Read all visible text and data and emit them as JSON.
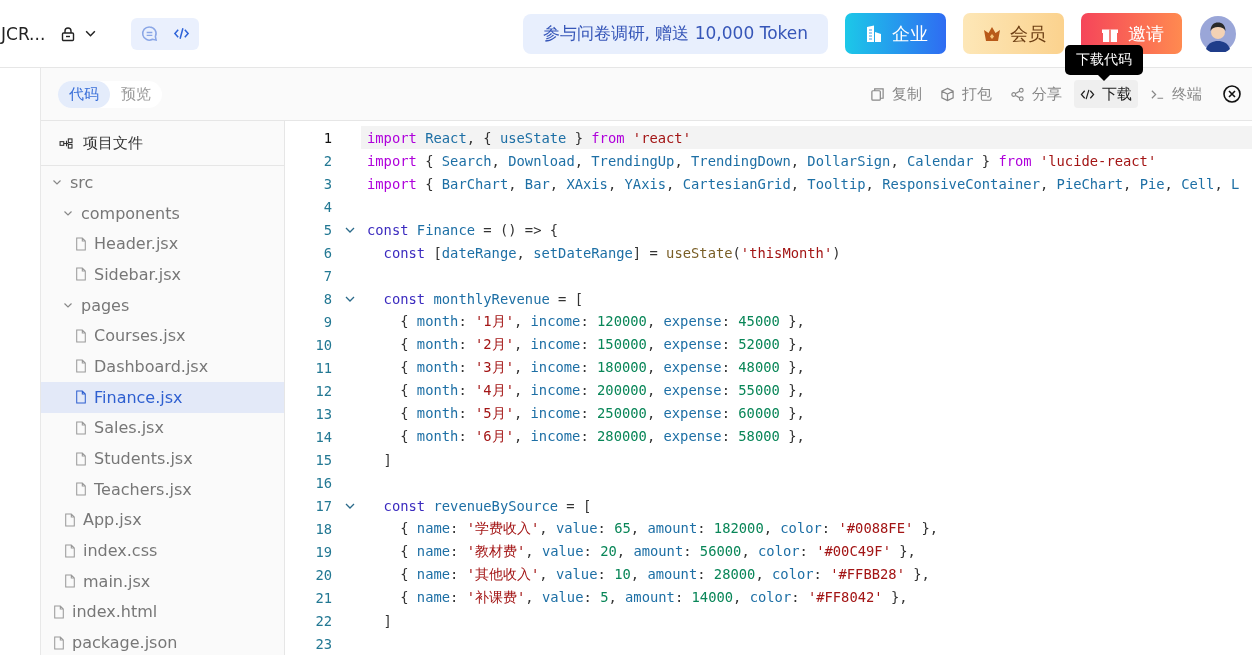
{
  "header": {
    "project_title": "JCR...",
    "view_toggle": [
      {
        "kind": "chat",
        "selected": false
      },
      {
        "kind": "code",
        "selected": true
      }
    ],
    "survey_banner": "参与问卷调研, 赠送 10,000 Token",
    "buttons": [
      {
        "kind": "enterprise",
        "label": "企业"
      },
      {
        "kind": "member",
        "label": "会员"
      },
      {
        "kind": "invite",
        "label": "邀请"
      }
    ]
  },
  "tooltip": "下载代码",
  "toolbar": {
    "tabs": [
      {
        "label": "代码",
        "selected": true
      },
      {
        "label": "预览",
        "selected": false
      }
    ],
    "actions": [
      {
        "kind": "copy",
        "label": "复制",
        "selected": false
      },
      {
        "kind": "package",
        "label": "打包",
        "selected": false
      },
      {
        "kind": "share",
        "label": "分享",
        "selected": false
      },
      {
        "kind": "code",
        "label": "下载",
        "selected": true
      },
      {
        "kind": "terminal",
        "label": "终端",
        "selected": false
      }
    ]
  },
  "sidebar": {
    "title": "项目文件",
    "tree": [
      {
        "name": "src",
        "kind": "folder",
        "expanded": true,
        "selected": false,
        "children": [
          {
            "name": "components",
            "kind": "folder",
            "expanded": true,
            "selected": false,
            "children": [
              {
                "name": "Header.jsx",
                "kind": "file",
                "selected": false
              },
              {
                "name": "Sidebar.jsx",
                "kind": "file",
                "selected": false
              }
            ]
          },
          {
            "name": "pages",
            "kind": "folder",
            "expanded": true,
            "selected": false,
            "children": [
              {
                "name": "Courses.jsx",
                "kind": "file",
                "selected": false
              },
              {
                "name": "Dashboard.jsx",
                "kind": "file",
                "selected": false
              },
              {
                "name": "Finance.jsx",
                "kind": "file",
                "selected": true
              },
              {
                "name": "Sales.jsx",
                "kind": "file",
                "selected": false
              },
              {
                "name": "Students.jsx",
                "kind": "file",
                "selected": false
              },
              {
                "name": "Teachers.jsx",
                "kind": "file",
                "selected": false
              }
            ]
          },
          {
            "name": "App.jsx",
            "kind": "file",
            "selected": false
          },
          {
            "name": "index.css",
            "kind": "file",
            "selected": false
          },
          {
            "name": "main.jsx",
            "kind": "file",
            "selected": false
          }
        ]
      },
      {
        "name": "index.html",
        "kind": "file",
        "selected": false
      },
      {
        "name": "package.json",
        "kind": "file",
        "selected": false
      }
    ]
  },
  "editor": {
    "lines": [
      {
        "number": "1",
        "active": true,
        "foldable": false,
        "tokens": [
          {
            "kind": "keyword",
            "text": "import"
          },
          {
            "kind": "name",
            "text": " React"
          },
          {
            "kind": "punct",
            "text": ", { "
          },
          {
            "kind": "name",
            "text": "useState"
          },
          {
            "kind": "punct",
            "text": " } "
          },
          {
            "kind": "keyword",
            "text": "from"
          },
          {
            "kind": "string",
            "text": " 'react'"
          }
        ]
      },
      {
        "number": "2",
        "active": false,
        "foldable": false,
        "tokens": [
          {
            "kind": "keyword",
            "text": "import"
          },
          {
            "kind": "punct",
            "text": " { "
          },
          {
            "kind": "name",
            "text": "Search"
          },
          {
            "kind": "punct",
            "text": ", "
          },
          {
            "kind": "name",
            "text": "Download"
          },
          {
            "kind": "punct",
            "text": ", "
          },
          {
            "kind": "name",
            "text": "TrendingUp"
          },
          {
            "kind": "punct",
            "text": ", "
          },
          {
            "kind": "name",
            "text": "TrendingDown"
          },
          {
            "kind": "punct",
            "text": ", "
          },
          {
            "kind": "name",
            "text": "DollarSign"
          },
          {
            "kind": "punct",
            "text": ", "
          },
          {
            "kind": "name",
            "text": "Calendar"
          },
          {
            "kind": "punct",
            "text": " } "
          },
          {
            "kind": "keyword",
            "text": "from"
          },
          {
            "kind": "string",
            "text": " 'lucide-react'"
          }
        ]
      },
      {
        "number": "3",
        "active": false,
        "foldable": false,
        "tokens": [
          {
            "kind": "keyword",
            "text": "import"
          },
          {
            "kind": "punct",
            "text": " { "
          },
          {
            "kind": "name",
            "text": "BarChart"
          },
          {
            "kind": "punct",
            "text": ", "
          },
          {
            "kind": "name",
            "text": "Bar"
          },
          {
            "kind": "punct",
            "text": ", "
          },
          {
            "kind": "name",
            "text": "XAxis"
          },
          {
            "kind": "punct",
            "text": ", "
          },
          {
            "kind": "name",
            "text": "YAxis"
          },
          {
            "kind": "punct",
            "text": ", "
          },
          {
            "kind": "name",
            "text": "CartesianGrid"
          },
          {
            "kind": "punct",
            "text": ", "
          },
          {
            "kind": "name",
            "text": "Tooltip"
          },
          {
            "kind": "punct",
            "text": ", "
          },
          {
            "kind": "name",
            "text": "ResponsiveContainer"
          },
          {
            "kind": "punct",
            "text": ", "
          },
          {
            "kind": "name",
            "text": "PieChart"
          },
          {
            "kind": "punct",
            "text": ", "
          },
          {
            "kind": "name",
            "text": "Pie"
          },
          {
            "kind": "punct",
            "text": ", "
          },
          {
            "kind": "name",
            "text": "Cell"
          },
          {
            "kind": "punct",
            "text": ", "
          },
          {
            "kind": "name",
            "text": "L"
          }
        ]
      },
      {
        "number": "4",
        "active": false,
        "foldable": false
      },
      {
        "number": "5",
        "active": false,
        "foldable": true,
        "tokens": [
          {
            "kind": "declare",
            "text": "const"
          },
          {
            "kind": "name",
            "text": " Finance"
          },
          {
            "kind": "punct",
            "text": " = () => {"
          }
        ]
      },
      {
        "number": "6",
        "active": false,
        "foldable": false,
        "tokens": [
          {
            "kind": "declare",
            "text": "  const"
          },
          {
            "kind": "punct",
            "text": " ["
          },
          {
            "kind": "name",
            "text": "dateRange"
          },
          {
            "kind": "punct",
            "text": ", "
          },
          {
            "kind": "name",
            "text": "setDateRange"
          },
          {
            "kind": "punct",
            "text": "] = "
          },
          {
            "kind": "func",
            "text": "useState"
          },
          {
            "kind": "punct",
            "text": "("
          },
          {
            "kind": "string",
            "text": "'thisMonth'"
          },
          {
            "kind": "punct",
            "text": ")"
          }
        ]
      },
      {
        "number": "7",
        "active": false,
        "foldable": false
      },
      {
        "number": "8",
        "active": false,
        "foldable": true,
        "tokens": [
          {
            "kind": "declare",
            "text": "  const"
          },
          {
            "kind": "name",
            "text": " monthlyRevenue"
          },
          {
            "kind": "punct",
            "text": " = ["
          }
        ]
      },
      {
        "number": "9",
        "active": false,
        "foldable": false,
        "tokens": [
          {
            "kind": "punct",
            "text": "    { "
          },
          {
            "kind": "name",
            "text": "month"
          },
          {
            "kind": "punct",
            "text": ": "
          },
          {
            "kind": "string",
            "text": "'1月'"
          },
          {
            "kind": "punct",
            "text": ", "
          },
          {
            "kind": "name",
            "text": "income"
          },
          {
            "kind": "punct",
            "text": ": "
          },
          {
            "kind": "number",
            "text": "120000"
          },
          {
            "kind": "punct",
            "text": ", "
          },
          {
            "kind": "name",
            "text": "expense"
          },
          {
            "kind": "punct",
            "text": ": "
          },
          {
            "kind": "number",
            "text": "45000"
          },
          {
            "kind": "punct",
            "text": " },"
          }
        ]
      },
      {
        "number": "10",
        "active": false,
        "foldable": false,
        "tokens": [
          {
            "kind": "punct",
            "text": "    { "
          },
          {
            "kind": "name",
            "text": "month"
          },
          {
            "kind": "punct",
            "text": ": "
          },
          {
            "kind": "string",
            "text": "'2月'"
          },
          {
            "kind": "punct",
            "text": ", "
          },
          {
            "kind": "name",
            "text": "income"
          },
          {
            "kind": "punct",
            "text": ": "
          },
          {
            "kind": "number",
            "text": "150000"
          },
          {
            "kind": "punct",
            "text": ", "
          },
          {
            "kind": "name",
            "text": "expense"
          },
          {
            "kind": "punct",
            "text": ": "
          },
          {
            "kind": "number",
            "text": "52000"
          },
          {
            "kind": "punct",
            "text": " },"
          }
        ]
      },
      {
        "number": "11",
        "active": false,
        "foldable": false,
        "tokens": [
          {
            "kind": "punct",
            "text": "    { "
          },
          {
            "kind": "name",
            "text": "month"
          },
          {
            "kind": "punct",
            "text": ": "
          },
          {
            "kind": "string",
            "text": "'3月'"
          },
          {
            "kind": "punct",
            "text": ", "
          },
          {
            "kind": "name",
            "text": "income"
          },
          {
            "kind": "punct",
            "text": ": "
          },
          {
            "kind": "number",
            "text": "180000"
          },
          {
            "kind": "punct",
            "text": ", "
          },
          {
            "kind": "name",
            "text": "expense"
          },
          {
            "kind": "punct",
            "text": ": "
          },
          {
            "kind": "number",
            "text": "48000"
          },
          {
            "kind": "punct",
            "text": " },"
          }
        ]
      },
      {
        "number": "12",
        "active": false,
        "foldable": false,
        "tokens": [
          {
            "kind": "punct",
            "text": "    { "
          },
          {
            "kind": "name",
            "text": "month"
          },
          {
            "kind": "punct",
            "text": ": "
          },
          {
            "kind": "string",
            "text": "'4月'"
          },
          {
            "kind": "punct",
            "text": ", "
          },
          {
            "kind": "name",
            "text": "income"
          },
          {
            "kind": "punct",
            "text": ": "
          },
          {
            "kind": "number",
            "text": "200000"
          },
          {
            "kind": "punct",
            "text": ", "
          },
          {
            "kind": "name",
            "text": "expense"
          },
          {
            "kind": "punct",
            "text": ": "
          },
          {
            "kind": "number",
            "text": "55000"
          },
          {
            "kind": "punct",
            "text": " },"
          }
        ]
      },
      {
        "number": "13",
        "active": false,
        "foldable": false,
        "tokens": [
          {
            "kind": "punct",
            "text": "    { "
          },
          {
            "kind": "name",
            "text": "month"
          },
          {
            "kind": "punct",
            "text": ": "
          },
          {
            "kind": "string",
            "text": "'5月'"
          },
          {
            "kind": "punct",
            "text": ", "
          },
          {
            "kind": "name",
            "text": "income"
          },
          {
            "kind": "punct",
            "text": ": "
          },
          {
            "kind": "number",
            "text": "250000"
          },
          {
            "kind": "punct",
            "text": ", "
          },
          {
            "kind": "name",
            "text": "expense"
          },
          {
            "kind": "punct",
            "text": ": "
          },
          {
            "kind": "number",
            "text": "60000"
          },
          {
            "kind": "punct",
            "text": " },"
          }
        ]
      },
      {
        "number": "14",
        "active": false,
        "foldable": false,
        "tokens": [
          {
            "kind": "punct",
            "text": "    { "
          },
          {
            "kind": "name",
            "text": "month"
          },
          {
            "kind": "punct",
            "text": ": "
          },
          {
            "kind": "string",
            "text": "'6月'"
          },
          {
            "kind": "punct",
            "text": ", "
          },
          {
            "kind": "name",
            "text": "income"
          },
          {
            "kind": "punct",
            "text": ": "
          },
          {
            "kind": "number",
            "text": "280000"
          },
          {
            "kind": "punct",
            "text": ", "
          },
          {
            "kind": "name",
            "text": "expense"
          },
          {
            "kind": "punct",
            "text": ": "
          },
          {
            "kind": "number",
            "text": "58000"
          },
          {
            "kind": "punct",
            "text": " },"
          }
        ]
      },
      {
        "number": "15",
        "active": false,
        "foldable": false,
        "tokens": [
          {
            "kind": "punct",
            "text": "  ]"
          }
        ]
      },
      {
        "number": "16",
        "active": false,
        "foldable": false
      },
      {
        "number": "17",
        "active": false,
        "foldable": true,
        "tokens": [
          {
            "kind": "declare",
            "text": "  const"
          },
          {
            "kind": "name",
            "text": " revenueBySource"
          },
          {
            "kind": "punct",
            "text": " = ["
          }
        ]
      },
      {
        "number": "18",
        "active": false,
        "foldable": false,
        "tokens": [
          {
            "kind": "punct",
            "text": "    { "
          },
          {
            "kind": "name",
            "text": "name"
          },
          {
            "kind": "punct",
            "text": ": "
          },
          {
            "kind": "string",
            "text": "'学费收入'"
          },
          {
            "kind": "punct",
            "text": ", "
          },
          {
            "kind": "name",
            "text": "value"
          },
          {
            "kind": "punct",
            "text": ": "
          },
          {
            "kind": "number",
            "text": "65"
          },
          {
            "kind": "punct",
            "text": ", "
          },
          {
            "kind": "name",
            "text": "amount"
          },
          {
            "kind": "punct",
            "text": ": "
          },
          {
            "kind": "number",
            "text": "182000"
          },
          {
            "kind": "punct",
            "text": ", "
          },
          {
            "kind": "name",
            "text": "color"
          },
          {
            "kind": "punct",
            "text": ": "
          },
          {
            "kind": "string",
            "text": "'#0088FE'"
          },
          {
            "kind": "punct",
            "text": " },"
          }
        ]
      },
      {
        "number": "19",
        "active": false,
        "foldable": false,
        "tokens": [
          {
            "kind": "punct",
            "text": "    { "
          },
          {
            "kind": "name",
            "text": "name"
          },
          {
            "kind": "punct",
            "text": ": "
          },
          {
            "kind": "string",
            "text": "'教材费'"
          },
          {
            "kind": "punct",
            "text": ", "
          },
          {
            "kind": "name",
            "text": "value"
          },
          {
            "kind": "punct",
            "text": ": "
          },
          {
            "kind": "number",
            "text": "20"
          },
          {
            "kind": "punct",
            "text": ", "
          },
          {
            "kind": "name",
            "text": "amount"
          },
          {
            "kind": "punct",
            "text": ": "
          },
          {
            "kind": "number",
            "text": "56000"
          },
          {
            "kind": "punct",
            "text": ", "
          },
          {
            "kind": "name",
            "text": "color"
          },
          {
            "kind": "punct",
            "text": ": "
          },
          {
            "kind": "string",
            "text": "'#00C49F'"
          },
          {
            "kind": "punct",
            "text": " },"
          }
        ]
      },
      {
        "number": "20",
        "active": false,
        "foldable": false,
        "tokens": [
          {
            "kind": "punct",
            "text": "    { "
          },
          {
            "kind": "name",
            "text": "name"
          },
          {
            "kind": "punct",
            "text": ": "
          },
          {
            "kind": "string",
            "text": "'其他收入'"
          },
          {
            "kind": "punct",
            "text": ", "
          },
          {
            "kind": "name",
            "text": "value"
          },
          {
            "kind": "punct",
            "text": ": "
          },
          {
            "kind": "number",
            "text": "10"
          },
          {
            "kind": "punct",
            "text": ", "
          },
          {
            "kind": "name",
            "text": "amount"
          },
          {
            "kind": "punct",
            "text": ": "
          },
          {
            "kind": "number",
            "text": "28000"
          },
          {
            "kind": "punct",
            "text": ", "
          },
          {
            "kind": "name",
            "text": "color"
          },
          {
            "kind": "punct",
            "text": ": "
          },
          {
            "kind": "string",
            "text": "'#FFBB28'"
          },
          {
            "kind": "punct",
            "text": " },"
          }
        ]
      },
      {
        "number": "21",
        "active": false,
        "foldable": false,
        "tokens": [
          {
            "kind": "punct",
            "text": "    { "
          },
          {
            "kind": "name",
            "text": "name"
          },
          {
            "kind": "punct",
            "text": ": "
          },
          {
            "kind": "string",
            "text": "'补课费'"
          },
          {
            "kind": "punct",
            "text": ", "
          },
          {
            "kind": "name",
            "text": "value"
          },
          {
            "kind": "punct",
            "text": ": "
          },
          {
            "kind": "number",
            "text": "5"
          },
          {
            "kind": "punct",
            "text": ", "
          },
          {
            "kind": "name",
            "text": "amount"
          },
          {
            "kind": "punct",
            "text": ": "
          },
          {
            "kind": "number",
            "text": "14000"
          },
          {
            "kind": "punct",
            "text": ", "
          },
          {
            "kind": "name",
            "text": "color"
          },
          {
            "kind": "punct",
            "text": ": "
          },
          {
            "kind": "string",
            "text": "'#FF8042'"
          },
          {
            "kind": "punct",
            "text": " },"
          }
        ]
      },
      {
        "number": "22",
        "active": false,
        "foldable": false,
        "tokens": [
          {
            "kind": "punct",
            "text": "  ]"
          }
        ]
      },
      {
        "number": "23",
        "active": false,
        "foldable": false
      }
    ]
  }
}
